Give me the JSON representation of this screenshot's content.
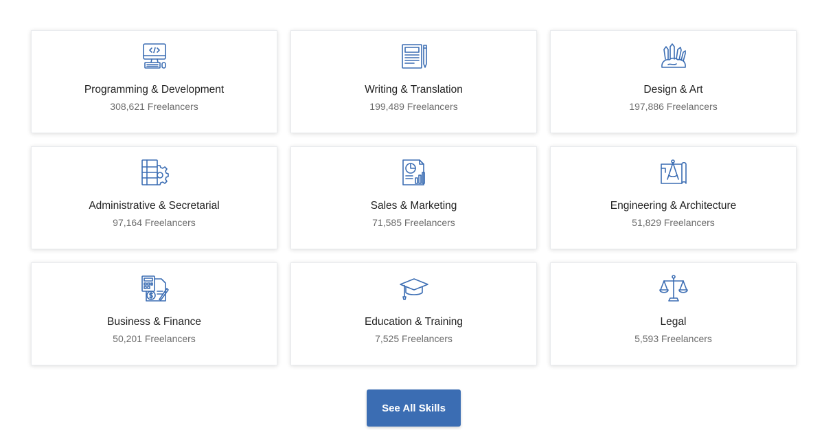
{
  "accent_color": "#3b6db3",
  "categories": [
    {
      "title": "Programming & Development",
      "count": "308,621 Freelancers",
      "icon": "computer-code-icon"
    },
    {
      "title": "Writing & Translation",
      "count": "199,489 Freelancers",
      "icon": "document-writing-icon"
    },
    {
      "title": "Design & Art",
      "count": "197,886 Freelancers",
      "icon": "art-tools-icon"
    },
    {
      "title": "Administrative & Secretarial",
      "count": "97,164 Freelancers",
      "icon": "binder-gear-icon"
    },
    {
      "title": "Sales & Marketing",
      "count": "71,585 Freelancers",
      "icon": "report-chart-icon"
    },
    {
      "title": "Engineering & Architecture",
      "count": "51,829 Freelancers",
      "icon": "blueprint-compass-icon"
    },
    {
      "title": "Business & Finance",
      "count": "50,201 Freelancers",
      "icon": "calculator-dollar-icon"
    },
    {
      "title": "Education & Training",
      "count": "7,525 Freelancers",
      "icon": "graduation-cap-icon"
    },
    {
      "title": "Legal",
      "count": "5,593 Freelancers",
      "icon": "scales-icon"
    }
  ],
  "see_all_label": "See All Skills"
}
